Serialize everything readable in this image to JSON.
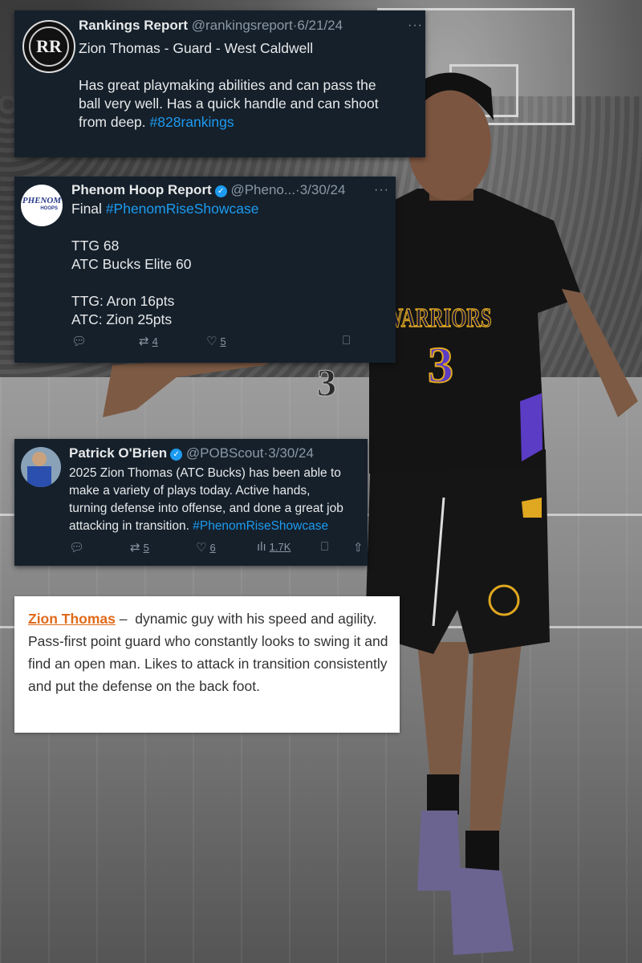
{
  "tweets": [
    {
      "avatar_icon": "rr-logo-icon",
      "avatar_text": "RR",
      "name": "Rankings Report",
      "handle": "@rankingsreport",
      "date": "6/21/24",
      "lines": [
        "Zion Thomas - Guard - West Caldwell",
        "",
        "Has great playmaking abilities and can pass the",
        "ball very well. Has a quick handle and can shoot",
        "from deep."
      ],
      "hashtag": "#828rankings"
    },
    {
      "avatar_icon": "phenom-hoops-logo-icon",
      "avatar_text": "PHENOM",
      "avatar_subtext": "HOOPS",
      "name": "Phenom Hoop Report",
      "handle": "@Pheno...",
      "date": "3/30/24",
      "first_line": "Final",
      "hashtag": "#PhenomRiseShowcase",
      "lines": [
        "TTG 68",
        "ATC Bucks Elite 60",
        "",
        "TTG: Aron 16pts",
        "ATC: Zion 25pts"
      ],
      "retweets": "4",
      "likes": "5"
    },
    {
      "avatar_icon": "profile-photo-icon",
      "name": "Patrick O'Brien",
      "handle": "@POBScout",
      "date": "3/30/24",
      "lines": [
        "2025 Zion Thomas (ATC Bucks) has been able to",
        "make a variety of plays today. Active hands,",
        "turning defense into offense, and done a great job",
        "attacking in transition."
      ],
      "hashtag": "#PhenomRiseShowcase",
      "retweets": "5",
      "likes": "6",
      "views": "1.7K"
    }
  ],
  "note": {
    "link": "Zion Thomas",
    "dash": " –  ",
    "text": "dynamic guy with his speed and agility. Pass-first point guard who constantly looks to swing it and find an open man. Likes to attack in transition consistently and put the defense on the back foot."
  },
  "player": {
    "jersey_text": "WARRIORS",
    "jersey_number": "3",
    "background_number": "3"
  },
  "colors": {
    "card_bg": "#15202b",
    "link_blue": "#1d9bf0",
    "note_link_orange": "#e06a1b",
    "jersey_gold": "#e0a820",
    "jersey_purple": "#5b3cc4"
  }
}
